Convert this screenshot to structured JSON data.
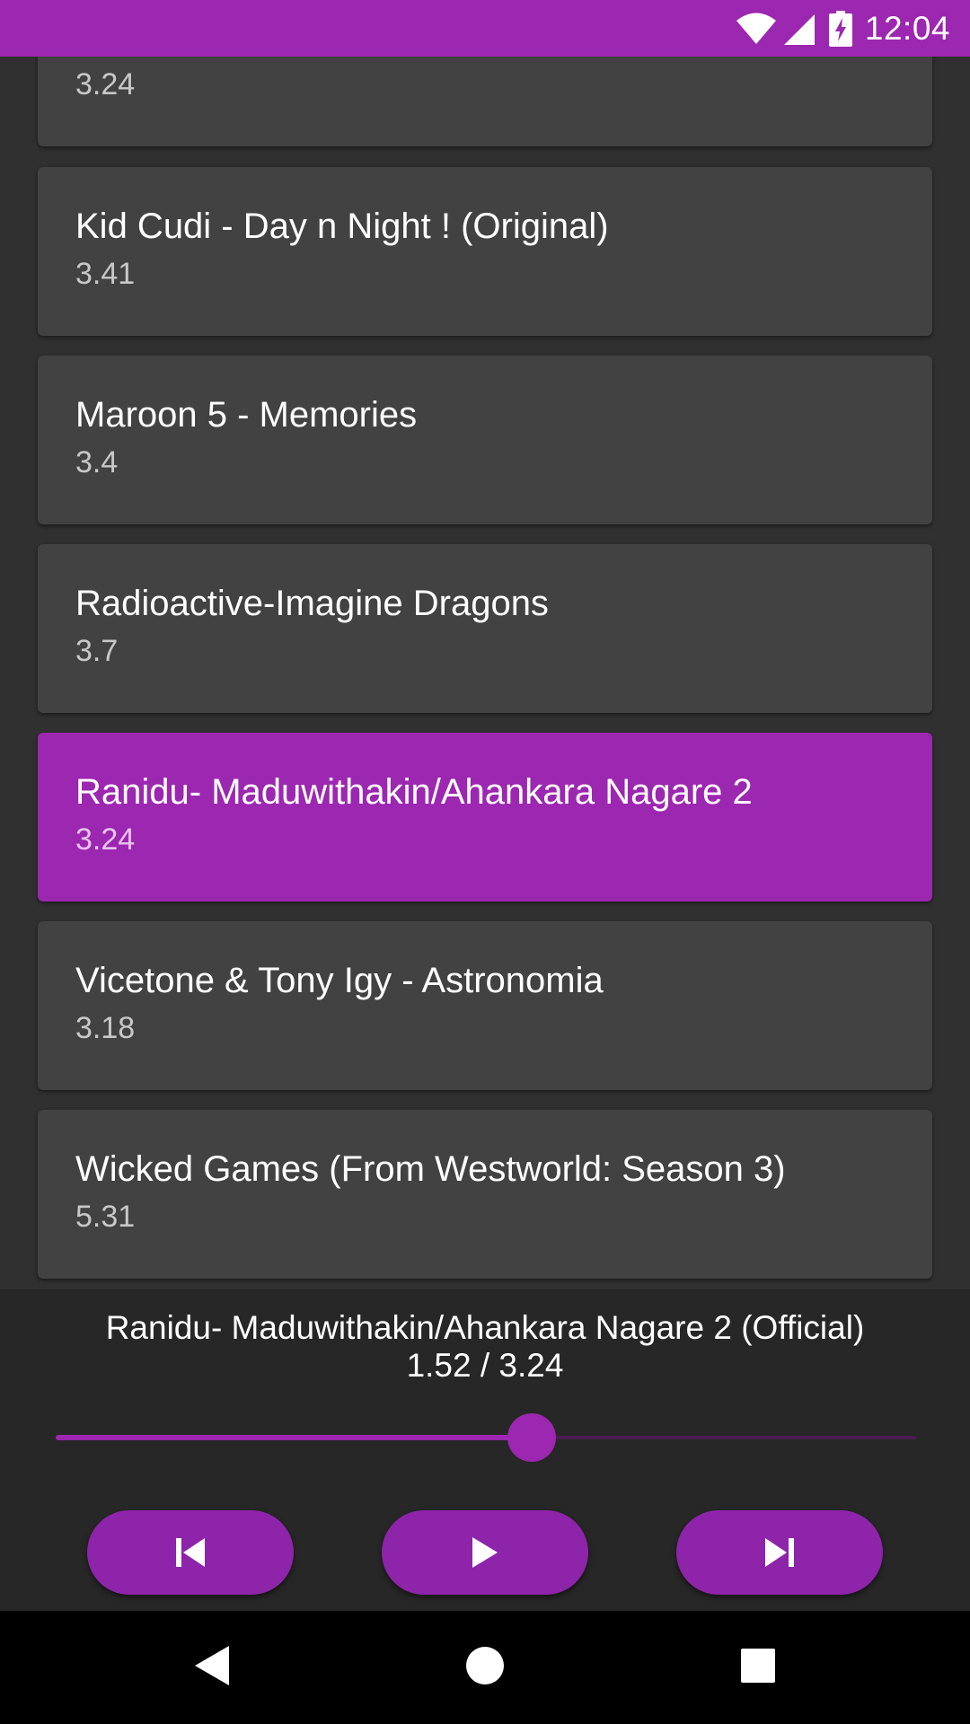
{
  "status_bar": {
    "time": "12:04",
    "icons": [
      "wifi-icon",
      "cell-signal-icon",
      "battery-charging-icon"
    ],
    "color": "#9c27b0"
  },
  "songs": [
    {
      "title": "",
      "duration": "3.24"
    },
    {
      "title": "Kid Cudi - Day n Night ! (Original)",
      "duration": "3.41"
    },
    {
      "title": "Maroon 5 - Memories",
      "duration": "3.4"
    },
    {
      "title": "Radioactive-Imagine Dragons",
      "duration": "3.7"
    },
    {
      "title": "Ranidu- Maduwithakin/Ahankara Nagare 2",
      "duration": "3.24",
      "active": true
    },
    {
      "title": "Vicetone & Tony Igy - Astronomia",
      "duration": "3.18"
    },
    {
      "title": "Wicked Games (From Westworld: Season 3)",
      "duration": "5.31"
    }
  ],
  "player": {
    "now_playing": "Ranidu- Maduwithakin/Ahankara Nagare 2 (Official)",
    "time_display": "1.52 / 3.24",
    "progress": 0.553,
    "controls": [
      "skip-previous-icon",
      "play-icon",
      "skip-next-icon"
    ],
    "accent": "#9c27b0"
  },
  "nav_bar": {
    "buttons": [
      "back-icon",
      "home-icon",
      "recents-icon"
    ]
  }
}
